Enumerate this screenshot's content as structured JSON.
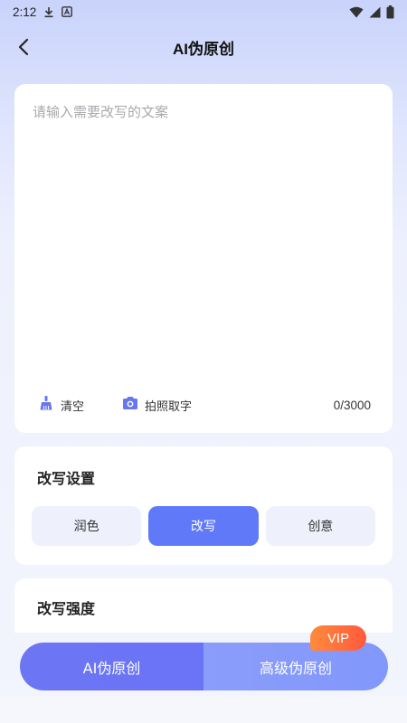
{
  "status_bar": {
    "time": "2:12",
    "icons": [
      "download-icon",
      "a-box-icon",
      "wifi-icon",
      "signal-icon",
      "battery-icon"
    ]
  },
  "nav": {
    "title": "AI伪原创"
  },
  "input": {
    "placeholder": "请输入需要改写的文案",
    "value": "",
    "clear_label": "清空",
    "photo_label": "拍照取字",
    "counter": "0/3000"
  },
  "settings": {
    "title": "改写设置",
    "modes": [
      {
        "label": "润色",
        "active": false
      },
      {
        "label": "改写",
        "active": true
      },
      {
        "label": "创意",
        "active": false
      }
    ]
  },
  "strength": {
    "title": "改写强度"
  },
  "actions": {
    "basic_label": "AI伪原创",
    "advanced_label": "高级伪原创",
    "vip_badge": "VIP"
  },
  "colors": {
    "accent": "#5f79f8",
    "vip": "#ff6a3c"
  }
}
